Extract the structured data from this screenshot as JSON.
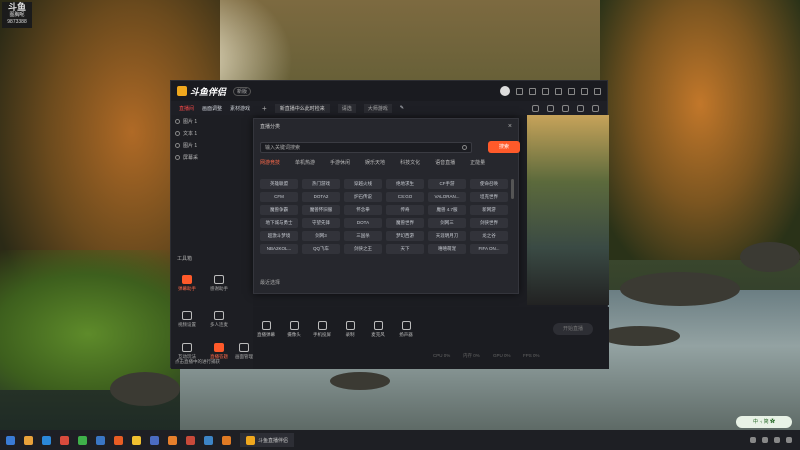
{
  "sticker": {
    "line1": "斗鱼",
    "line2": "图胸呢",
    "line3": "9873388"
  },
  "app": {
    "name": "斗鱼伴侣",
    "version": "新版",
    "tabs": [
      "直播间",
      "画面调整",
      "素材游戏"
    ],
    "stream_title": "新直播中么此时检来",
    "title_chip": "请选",
    "category_chip": "大师游戏",
    "sources": [
      "图片 1",
      "文本 1",
      "图片 1",
      "屏幕采"
    ],
    "tools_title": "工具箱",
    "tools": [
      "弹幕助手",
      "感谢助手",
      "视频设置",
      "多人连麦",
      "互动玩法",
      "直播答题",
      "画面管理",
      "美颜",
      "更多"
    ],
    "bottom_note": "点击直播中的进行捕获",
    "bottom_bar": [
      "直播弹幕",
      "摄像头",
      "手机投屏",
      "录制",
      "麦克风",
      "扬声器"
    ],
    "start_button": "开始直播",
    "stats": [
      "CPU 0%",
      "内存 0%",
      "GPU 0%",
      "FPS 0%"
    ]
  },
  "dialog": {
    "title": "直播分类",
    "search_placeholder": "输入关键词搜索",
    "search_button": "搜索",
    "categories": [
      "网游竞技",
      "单机热游",
      "手游休闲",
      "娱乐天地",
      "科技文化",
      "语音直播",
      "正能量"
    ],
    "games": [
      "英雄联盟",
      "热门游戏",
      "穿越火线",
      "绝地求生",
      "CF手游",
      "使命召唤",
      "CFM",
      "DOTA2",
      "炉石传说",
      "CS:GO",
      "VALORAN...",
      "坦克世界",
      "魔兽争霸",
      "魔兽怀旧服",
      "怀念拳",
      "传奇",
      "魔兽 4.7服",
      "新网游",
      "地下城与勇士",
      "守望先锋",
      "DOTA",
      "魔兽世界",
      "剑网三",
      "剑侠世界",
      "超激斗梦境",
      "剑网3",
      "三国杀",
      "梦幻西游",
      "天涯明月刀",
      "龙之谷",
      "NBA2KOL...",
      "QQ飞车",
      "剑侠之王",
      "天下",
      "嘻嘻萌宠",
      "FIFA ON..."
    ],
    "recent_label": "最近选择"
  },
  "taskbar": {
    "active_app": "斗鱼直播伴侣"
  },
  "ime": {
    "text": "中 ·₎ 简 ✿"
  }
}
